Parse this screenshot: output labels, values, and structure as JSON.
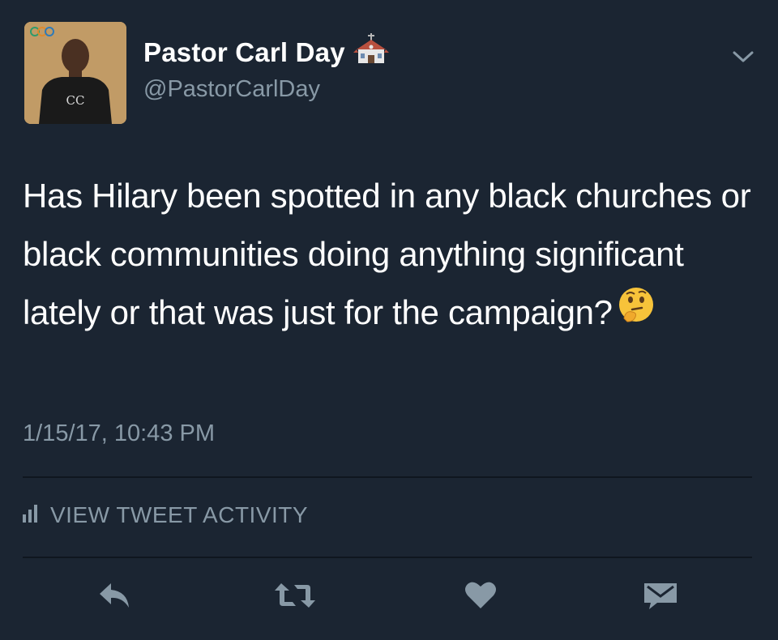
{
  "author": {
    "display_name": "Pastor Carl Day",
    "handle": "@PastorCarlDay",
    "badge_icon": "church-icon"
  },
  "tweet": {
    "text": "Has Hilary been spotted in any black churches or black communities doing anything significant lately or that was just for the campaign?",
    "emoji": "thinking-face-icon",
    "timestamp": "1/15/17, 10:43 PM"
  },
  "activity": {
    "label": "VIEW TWEET ACTIVITY",
    "icon": "bar-chart-icon"
  },
  "actions": [
    {
      "name": "reply",
      "icon": "reply-icon"
    },
    {
      "name": "retweet",
      "icon": "retweet-icon"
    },
    {
      "name": "like",
      "icon": "heart-icon"
    },
    {
      "name": "direct-message",
      "icon": "envelope-icon"
    }
  ],
  "colors": {
    "background": "#1b2532",
    "primary_text": "#ffffff",
    "secondary_text": "#8899a6",
    "icon": "#8899a6",
    "divider": "#0f161f"
  }
}
